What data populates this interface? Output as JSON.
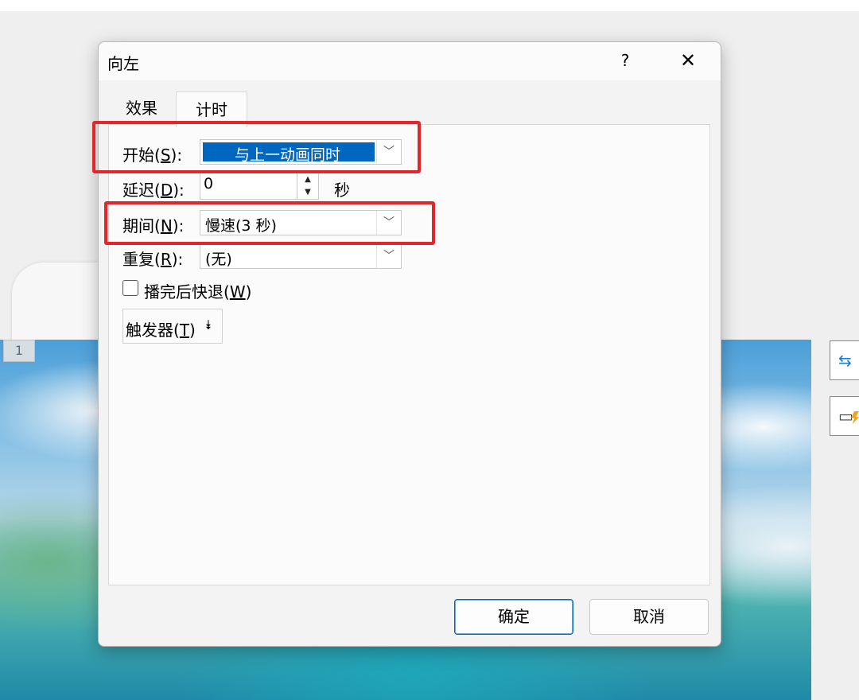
{
  "dialog": {
    "title": "向左",
    "help": "?",
    "close": "✕",
    "tabs": [
      "效果",
      "计时"
    ],
    "start": {
      "label": "开始(",
      "key": "S",
      "suffix": "):",
      "value": "与上一动画同时"
    },
    "delay": {
      "label": "延迟(",
      "key": "D",
      "suffix": "):",
      "value": "0",
      "unit": "秒"
    },
    "duration": {
      "label": "期间(",
      "key": "N",
      "suffix": "):",
      "value": "慢速(3 秒)"
    },
    "repeat": {
      "label": "重复(",
      "key": "R",
      "suffix": "):",
      "value": "(无)"
    },
    "rewind": {
      "label": "播完后快退(",
      "key": "W",
      "suffix": ")",
      "checked": false
    },
    "trigger": {
      "label": "触发器(",
      "key": "T",
      "suffix": ")",
      "chevron": "⯯"
    },
    "ok": "确定",
    "cancel": "取消"
  },
  "slide": {
    "number": "1"
  },
  "side_icons": [
    "swap-arrows-icon",
    "image-flash-icon"
  ],
  "colors": {
    "highlight": "#0067c0",
    "annotation": "#e3262a"
  }
}
